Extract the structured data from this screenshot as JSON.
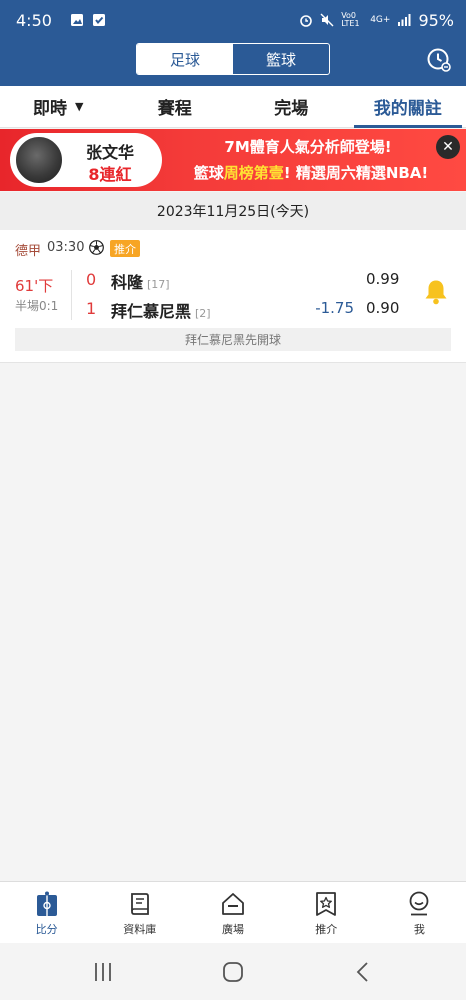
{
  "statusbar": {
    "time": "4:50",
    "network": "Vo0 LTE1",
    "signal4g": "4G+",
    "battery": "95%"
  },
  "header": {
    "sport_tabs": [
      {
        "label": "足球",
        "active": true
      },
      {
        "label": "籃球",
        "active": false
      }
    ]
  },
  "tabs": [
    {
      "label": "即時",
      "caret": "▼",
      "active": false
    },
    {
      "label": "賽程",
      "active": false
    },
    {
      "label": "完場",
      "active": false
    },
    {
      "label": "我的關註",
      "active": true
    }
  ],
  "banner": {
    "name": "张文华",
    "streak": "8連紅",
    "line1": "7M體育人氣分析師登場!",
    "line2_pre": "籃球",
    "line2_hl": "周榜第壹",
    "line2_post": "! 精選周六精選NBA!",
    "close": "✕"
  },
  "date_bar": "2023年11月25日(今天)",
  "match": {
    "league": "德甲",
    "time": "03:30",
    "tag": "推介",
    "minute": "61'下",
    "half_time": "半場0:1",
    "teams": [
      {
        "score": "0",
        "name": "科隆",
        "rank": "[17]",
        "handicap": "",
        "odds": "0.99"
      },
      {
        "score": "1",
        "name": "拜仁慕尼黑",
        "rank": "[2]",
        "handicap": "-1.75",
        "odds": "0.90"
      }
    ],
    "note": "拜仁慕尼黑先開球"
  },
  "bottom_nav": [
    {
      "label": "比分",
      "icon": "scoreboard-icon",
      "active": true
    },
    {
      "label": "資料庫",
      "icon": "book-icon",
      "active": false
    },
    {
      "label": "廣場",
      "icon": "plaza-icon",
      "active": false
    },
    {
      "label": "推介",
      "icon": "star-bookmark-icon",
      "active": false
    },
    {
      "label": "我",
      "icon": "profile-icon",
      "active": false
    }
  ],
  "colors": {
    "brand": "#2b5a96",
    "live_red": "#e03b3b",
    "banner_red": "#f43b39",
    "tag_orange": "#f7a524",
    "bell_yellow": "#f7c21e"
  }
}
